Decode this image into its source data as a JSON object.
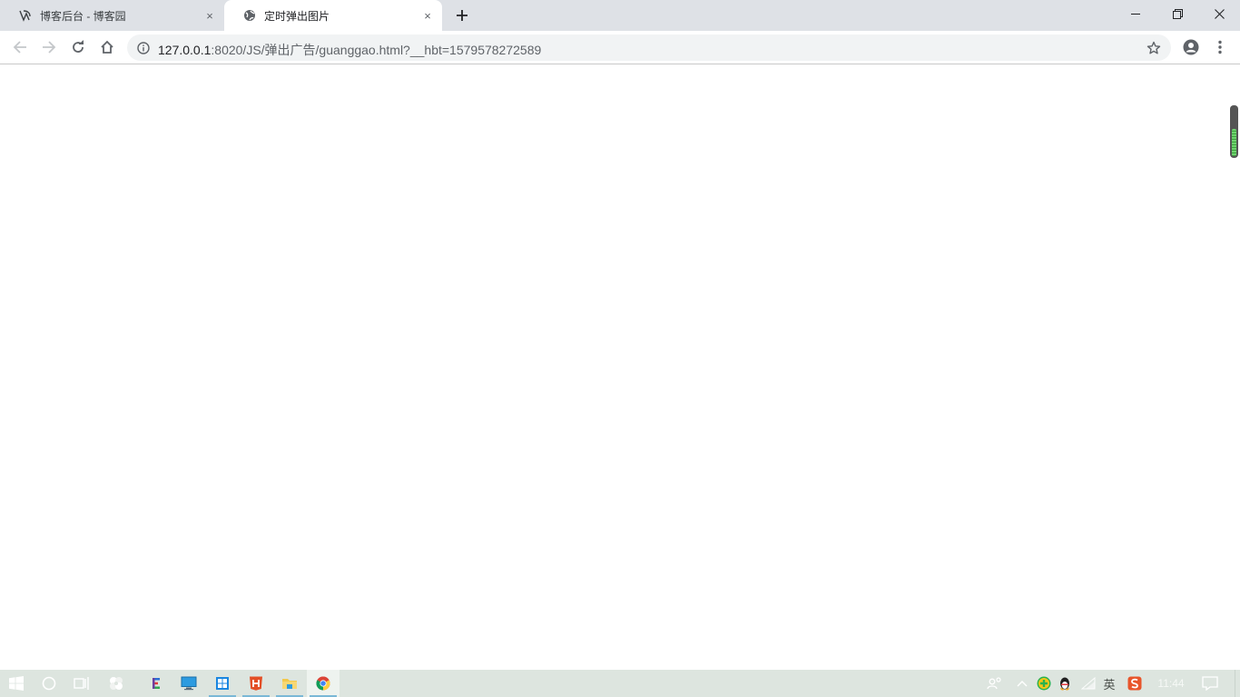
{
  "browser": {
    "tabs": [
      {
        "title": "博客后台 - 博客园",
        "favicon": "cnblogs-icon",
        "active": false
      },
      {
        "title": "定时弹出图片",
        "favicon": "globe-icon",
        "active": true
      }
    ],
    "close_glyph": "×",
    "new_tab_icon": "plus-icon",
    "window_controls": [
      "minimize-icon",
      "restore-icon",
      "close-icon"
    ]
  },
  "toolbar": {
    "nav_icons": [
      "back-arrow-icon",
      "forward-arrow-icon",
      "reload-icon",
      "home-icon"
    ],
    "address": {
      "host": "127.0.0.1",
      "rest": ":8020/JS/弹出广告/guanggao.html?__hbt=1579578272589"
    },
    "right_icons": [
      "bookmark-star-icon",
      "profile-icon",
      "menu-kebab-icon"
    ]
  },
  "page": {
    "scroll_indicator_level": 0.55
  },
  "taskbar": {
    "apps": [
      "windows-start-icon",
      "cortana-circle-icon",
      "task-view-icon",
      "pinwheel-app-icon",
      "hbuilder-e-icon",
      "this-pc-icon",
      "store-icon",
      "html5-editor-icon",
      "file-explorer-icon",
      "chrome-icon"
    ],
    "tray_icons": [
      "people-icon",
      "chevron-up-icon",
      "qq-green-icon",
      "qq-penguin-icon",
      "network-icon",
      "input-method-icon",
      "sogou-s-icon"
    ],
    "ime_label": "英",
    "clock": "11:44",
    "notification_icon": "action-center-icon"
  },
  "colors": {
    "tabstrip": "#dee1e6",
    "omnibox": "#f1f3f4",
    "taskbar": "#dde5df",
    "indicator_green": "#3aa33a"
  }
}
